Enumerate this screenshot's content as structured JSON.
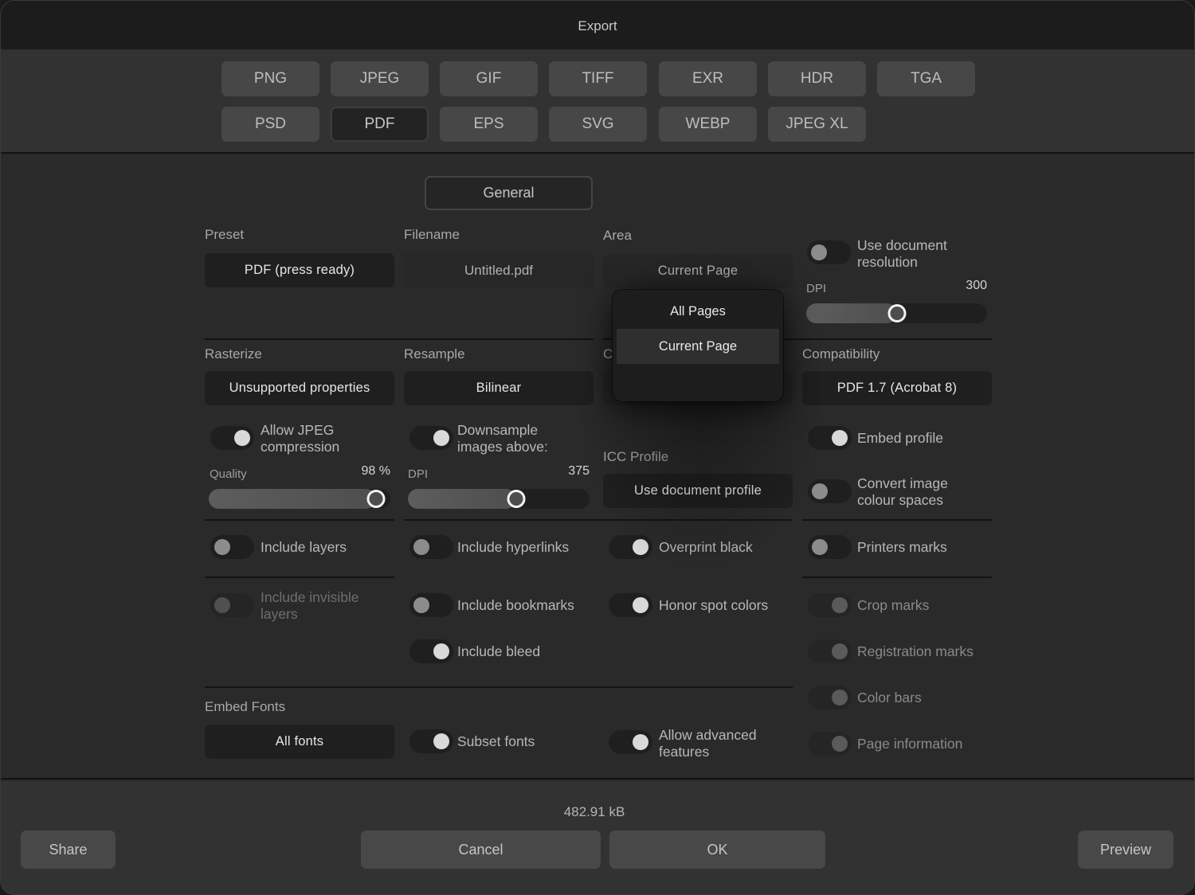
{
  "window": {
    "title": "Export"
  },
  "formats": {
    "row1": [
      "PNG",
      "JPEG",
      "GIF",
      "TIFF",
      "EXR",
      "HDR",
      "TGA"
    ],
    "row2": [
      "PSD",
      "PDF",
      "EPS",
      "SVG",
      "WEBP",
      "JPEG XL"
    ],
    "selected": "PDF"
  },
  "section": {
    "label": "General"
  },
  "preset": {
    "label": "Preset",
    "value": "PDF (press ready)"
  },
  "filename": {
    "label": "Filename",
    "value": "Untitled.pdf"
  },
  "area": {
    "label": "Area",
    "value": "Current Page",
    "options": [
      "All Pages",
      "Current Page"
    ],
    "selected": "Current Page"
  },
  "resolution": {
    "use_document_label": "Use document resolution",
    "use_document_on": false,
    "dpi_label": "DPI",
    "dpi_value": "300",
    "dpi_fraction": 0.5
  },
  "rasterize": {
    "label": "Rasterize",
    "value": "Unsupported properties"
  },
  "resample": {
    "label": "Resample",
    "value": "Bilinear"
  },
  "hidden_column_label": "C",
  "compatibility": {
    "label": "Compatibility",
    "value": "PDF 1.7 (Acrobat 8)"
  },
  "jpeg": {
    "allow_label": "Allow JPEG compression",
    "allow_on": true,
    "quality_label": "Quality",
    "quality_value": "98 %",
    "quality_fraction": 0.98
  },
  "downsample": {
    "label": "Downsample images above:",
    "on": true,
    "dpi_label": "DPI",
    "dpi_value": "375",
    "dpi_fraction": 0.61
  },
  "icc": {
    "label": "ICC Profile",
    "value": "Use document profile"
  },
  "toggles": {
    "embed_profile": {
      "label": "Embed profile",
      "on": true
    },
    "convert_colour": {
      "label": "Convert image colour spaces",
      "on": false
    },
    "include_layers": {
      "label": "Include layers",
      "on": false
    },
    "include_invisible_layers": {
      "label": "Include invisible layers",
      "on": false,
      "disabled": true
    },
    "include_hyperlinks": {
      "label": "Include hyperlinks",
      "on": false
    },
    "include_bookmarks": {
      "label": "Include bookmarks",
      "on": false
    },
    "include_bleed": {
      "label": "Include bleed",
      "on": true
    },
    "overprint_black": {
      "label": "Overprint black",
      "on": true
    },
    "honor_spot_colors": {
      "label": "Honor spot colors",
      "on": true
    },
    "printers_marks": {
      "label": "Printers marks",
      "on": false
    },
    "crop_marks": {
      "label": "Crop marks",
      "on": true,
      "disabled": true
    },
    "registration_marks": {
      "label": "Registration marks",
      "on": true,
      "disabled": true
    },
    "color_bars": {
      "label": "Color bars",
      "on": true,
      "disabled": true
    },
    "page_information": {
      "label": "Page information",
      "on": true,
      "disabled": true
    },
    "subset_fonts": {
      "label": "Subset fonts",
      "on": true
    },
    "allow_advanced": {
      "label": "Allow advanced features",
      "on": true
    }
  },
  "embed_fonts": {
    "label": "Embed Fonts",
    "value": "All fonts"
  },
  "footer": {
    "file_size": "482.91 kB",
    "share": "Share",
    "cancel": "Cancel",
    "ok": "OK",
    "preview": "Preview"
  }
}
